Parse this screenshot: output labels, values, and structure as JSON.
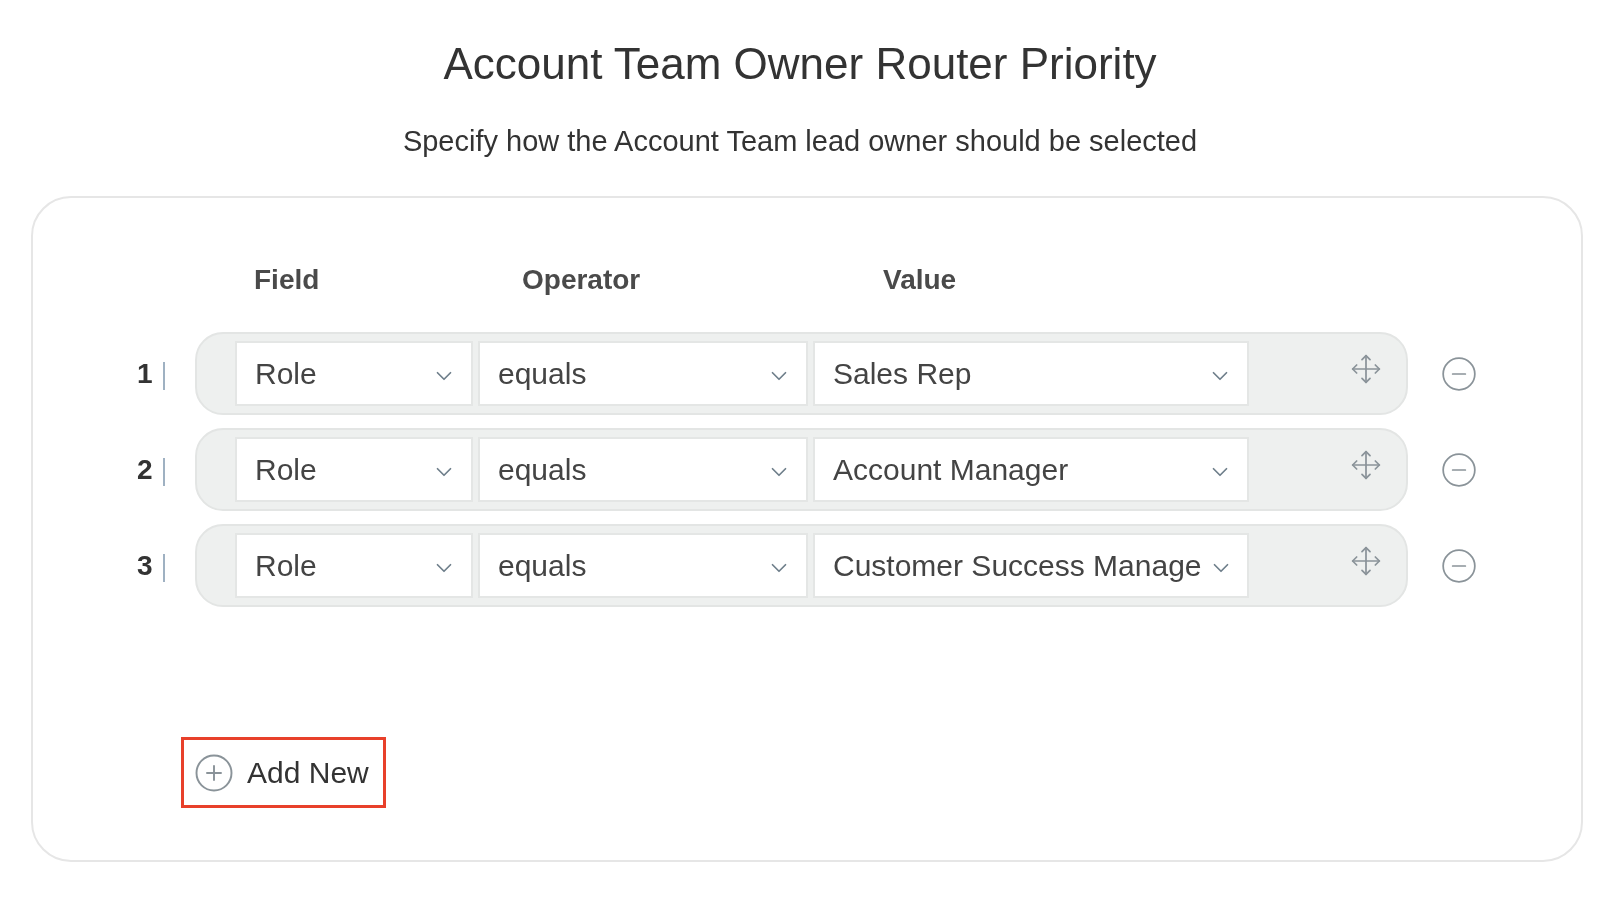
{
  "title": "Account Team Owner Router Priority",
  "subtitle": "Specify how the Account Team lead owner should be selected",
  "table": {
    "columns": [
      "Field",
      "Operator",
      "Value"
    ],
    "rows": [
      {
        "number": "1",
        "field": "Role",
        "operator": "equals",
        "value": "Sales Rep"
      },
      {
        "number": "2",
        "field": "Role",
        "operator": "equals",
        "value": "Account Manager"
      },
      {
        "number": "3",
        "field": "Role",
        "operator": "equals",
        "value": "Customer Success Manage"
      }
    ]
  },
  "add_button": {
    "label": "Add New",
    "highlighted": true
  }
}
